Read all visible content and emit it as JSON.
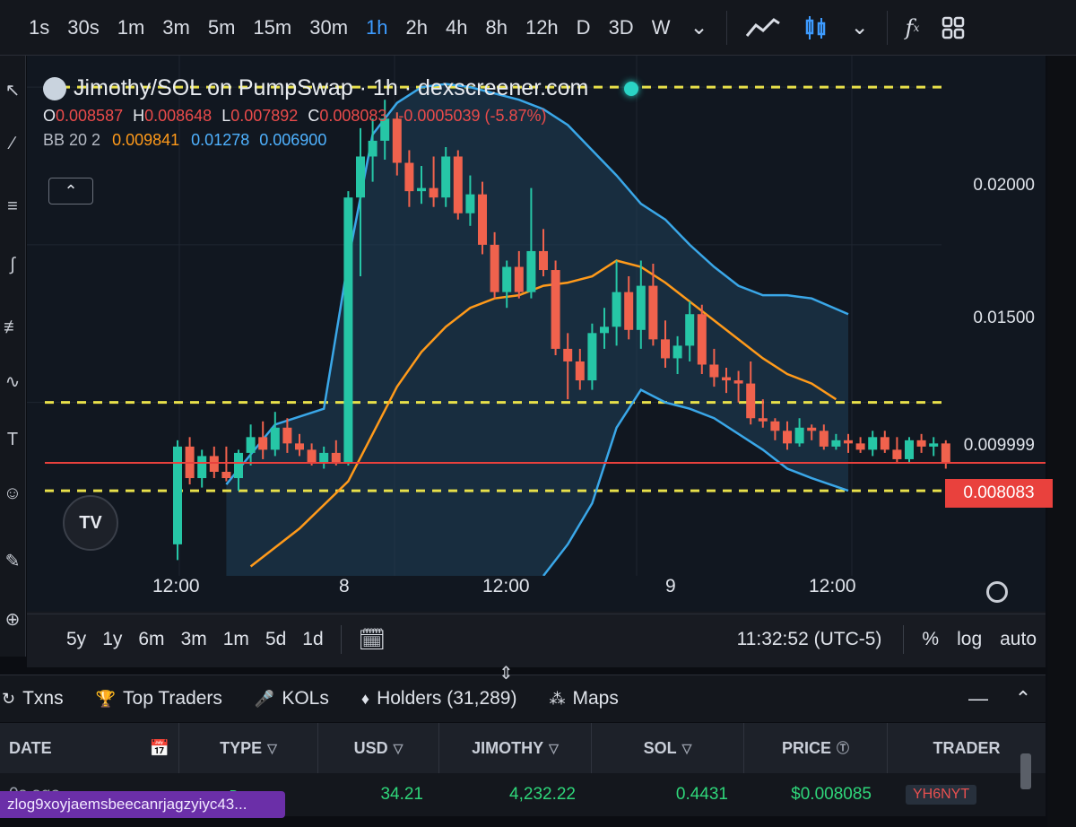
{
  "topbar": {
    "timeframes": [
      "1s",
      "30s",
      "1m",
      "3m",
      "5m",
      "15m",
      "30m",
      "1h",
      "2h",
      "4h",
      "8h",
      "12h",
      "D",
      "3D",
      "W"
    ],
    "active": "1h",
    "icons": [
      "chevron-down-icon",
      "line-chart-icon",
      "candles-icon",
      "chevron-down-icon",
      "indicators-fx-icon",
      "layout-grid-icon"
    ]
  },
  "legend": {
    "title": "Jimothy/SOL on PumpSwap · 1h · dexscreener.com",
    "o_label": "O",
    "o": "0.008587",
    "h_label": "H",
    "h": "0.008648",
    "l_label": "L",
    "l": "0.007892",
    "c_label": "C",
    "c": "0.008083",
    "change": "-0.0005039 (-5.87%)",
    "bb_label": "BB 20 2",
    "bb_mid": "0.009841",
    "bb_upper": "0.01278",
    "bb_lower": "0.006900"
  },
  "axis": {
    "price_labels": [
      "0.02000",
      "0.01500",
      "0.009999"
    ],
    "current_price": "0.008083",
    "time_labels": [
      "12:00",
      "8",
      "12:00",
      "9",
      "12:00"
    ]
  },
  "chart_data": {
    "type": "candlestick",
    "ylim": [
      0.0045,
      0.021
    ],
    "colors": {
      "up": "#26c6a6",
      "down": "#f0624d",
      "bb_mid": "#ff9a1a",
      "bb_band": "#3aa7e8",
      "hline": "#e8e04a",
      "price_line": "#e9413d"
    },
    "horizontal_lines": [
      0.02,
      0.01,
      0.0072
    ],
    "candles": [
      [
        0.0055,
        0.0088,
        0.005,
        0.0086
      ],
      [
        0.0086,
        0.0089,
        0.0074,
        0.0076
      ],
      [
        0.0076,
        0.0085,
        0.0073,
        0.0083
      ],
      [
        0.0083,
        0.0086,
        0.0076,
        0.0078
      ],
      [
        0.0078,
        0.0086,
        0.0075,
        0.0076
      ],
      [
        0.0076,
        0.0085,
        0.0072,
        0.0084
      ],
      [
        0.0084,
        0.0093,
        0.008,
        0.0089
      ],
      [
        0.0089,
        0.0094,
        0.0082,
        0.0085
      ],
      [
        0.0085,
        0.0097,
        0.0083,
        0.0092
      ],
      [
        0.0092,
        0.0095,
        0.0084,
        0.0087
      ],
      [
        0.0087,
        0.009,
        0.0083,
        0.0085
      ],
      [
        0.0085,
        0.0087,
        0.008,
        0.0081
      ],
      [
        0.0081,
        0.0086,
        0.0079,
        0.0084
      ],
      [
        0.0084,
        0.0088,
        0.008,
        0.0081
      ],
      [
        0.0081,
        0.0167,
        0.008,
        0.0165
      ],
      [
        0.0165,
        0.0187,
        0.014,
        0.0178
      ],
      [
        0.0178,
        0.019,
        0.017,
        0.0183
      ],
      [
        0.0183,
        0.0196,
        0.0177,
        0.019
      ],
      [
        0.019,
        0.0192,
        0.0172,
        0.0176
      ],
      [
        0.0176,
        0.018,
        0.0162,
        0.0167
      ],
      [
        0.0167,
        0.0175,
        0.0163,
        0.0168
      ],
      [
        0.0168,
        0.0178,
        0.0162,
        0.0165
      ],
      [
        0.0165,
        0.0181,
        0.0162,
        0.0178
      ],
      [
        0.0178,
        0.018,
        0.0158,
        0.016
      ],
      [
        0.016,
        0.0172,
        0.0156,
        0.0166
      ],
      [
        0.0166,
        0.017,
        0.0147,
        0.015
      ],
      [
        0.015,
        0.0154,
        0.0133,
        0.0135
      ],
      [
        0.0135,
        0.0145,
        0.013,
        0.0143
      ],
      [
        0.0143,
        0.0148,
        0.0133,
        0.0135
      ],
      [
        0.0135,
        0.0168,
        0.0133,
        0.0148
      ],
      [
        0.0148,
        0.0155,
        0.014,
        0.0142
      ],
      [
        0.0142,
        0.0145,
        0.0115,
        0.0117
      ],
      [
        0.0117,
        0.0122,
        0.0101,
        0.0113
      ],
      [
        0.0113,
        0.0117,
        0.0104,
        0.0107
      ],
      [
        0.0107,
        0.0125,
        0.0104,
        0.0122
      ],
      [
        0.0122,
        0.013,
        0.0117,
        0.0124
      ],
      [
        0.0124,
        0.0145,
        0.0118,
        0.0135
      ],
      [
        0.0135,
        0.014,
        0.012,
        0.0123
      ],
      [
        0.0123,
        0.0145,
        0.0117,
        0.0137
      ],
      [
        0.0137,
        0.0144,
        0.0118,
        0.012
      ],
      [
        0.012,
        0.0126,
        0.0111,
        0.0114
      ],
      [
        0.0114,
        0.0121,
        0.0109,
        0.0118
      ],
      [
        0.0118,
        0.0132,
        0.0113,
        0.0128
      ],
      [
        0.0128,
        0.0131,
        0.0109,
        0.0112
      ],
      [
        0.0112,
        0.0117,
        0.0105,
        0.0108
      ],
      [
        0.0108,
        0.0111,
        0.0103,
        0.0107
      ],
      [
        0.0107,
        0.011,
        0.01,
        0.0106
      ],
      [
        0.0106,
        0.0113,
        0.0093,
        0.0095
      ],
      [
        0.0095,
        0.0101,
        0.0092,
        0.0094
      ],
      [
        0.0094,
        0.0095,
        0.0088,
        0.0091
      ],
      [
        0.0091,
        0.0094,
        0.0085,
        0.0087
      ],
      [
        0.0087,
        0.0095,
        0.0086,
        0.0092
      ],
      [
        0.0092,
        0.0093,
        0.0088,
        0.0091
      ],
      [
        0.0091,
        0.0093,
        0.0085,
        0.0086
      ],
      [
        0.0086,
        0.009,
        0.0085,
        0.0088
      ],
      [
        0.0088,
        0.009,
        0.0084,
        0.0087
      ],
      [
        0.0087,
        0.0089,
        0.0084,
        0.0085
      ],
      [
        0.0085,
        0.0091,
        0.0083,
        0.0089
      ],
      [
        0.0089,
        0.0091,
        0.0084,
        0.0085
      ],
      [
        0.0085,
        0.0089,
        0.0081,
        0.0082
      ],
      [
        0.0082,
        0.0089,
        0.0081,
        0.0088
      ],
      [
        0.0088,
        0.009,
        0.0084,
        0.0086
      ],
      [
        0.0086,
        0.0089,
        0.0083,
        0.0087
      ],
      [
        0.0087,
        0.0088,
        0.0079,
        0.0081
      ]
    ],
    "bb_upper": [
      [
        4,
        0.0074
      ],
      [
        8,
        0.0093
      ],
      [
        12,
        0.0098
      ],
      [
        14,
        0.0145
      ],
      [
        16,
        0.0185
      ],
      [
        18,
        0.0195
      ],
      [
        20,
        0.02
      ],
      [
        22,
        0.0201
      ],
      [
        24,
        0.02
      ],
      [
        26,
        0.0198
      ],
      [
        28,
        0.0196
      ],
      [
        30,
        0.0193
      ],
      [
        32,
        0.0188
      ],
      [
        34,
        0.018
      ],
      [
        36,
        0.0172
      ],
      [
        38,
        0.0163
      ],
      [
        40,
        0.0158
      ],
      [
        42,
        0.015
      ],
      [
        44,
        0.0143
      ],
      [
        46,
        0.0137
      ],
      [
        48,
        0.0134
      ],
      [
        50,
        0.0134
      ],
      [
        52,
        0.0133
      ],
      [
        55,
        0.0128
      ]
    ],
    "bb_mid": [
      [
        6,
        0.0048
      ],
      [
        10,
        0.006
      ],
      [
        14,
        0.0075
      ],
      [
        16,
        0.009
      ],
      [
        18,
        0.0105
      ],
      [
        20,
        0.0116
      ],
      [
        22,
        0.0124
      ],
      [
        24,
        0.013
      ],
      [
        26,
        0.0133
      ],
      [
        28,
        0.0134
      ],
      [
        30,
        0.0137
      ],
      [
        32,
        0.0138
      ],
      [
        34,
        0.014
      ],
      [
        36,
        0.0145
      ],
      [
        38,
        0.0143
      ],
      [
        40,
        0.0138
      ],
      [
        42,
        0.0132
      ],
      [
        44,
        0.0126
      ],
      [
        46,
        0.012
      ],
      [
        48,
        0.0114
      ],
      [
        50,
        0.0109
      ],
      [
        52,
        0.0106
      ],
      [
        54,
        0.0101
      ]
    ],
    "bb_lower": [
      [
        30,
        0.0045
      ],
      [
        32,
        0.0055
      ],
      [
        34,
        0.0068
      ],
      [
        36,
        0.0092
      ],
      [
        38,
        0.0104
      ],
      [
        40,
        0.01
      ],
      [
        42,
        0.0098
      ],
      [
        44,
        0.0095
      ],
      [
        46,
        0.009
      ],
      [
        48,
        0.0085
      ],
      [
        50,
        0.0079
      ],
      [
        52,
        0.0076
      ],
      [
        55,
        0.0072
      ]
    ]
  },
  "rangebar": {
    "ranges": [
      "5y",
      "1y",
      "6m",
      "3m",
      "1m",
      "5d",
      "1d"
    ],
    "clock": "11:32:52 (UTC-5)",
    "opts": [
      "%",
      "log",
      "auto"
    ]
  },
  "tabs": {
    "items": [
      {
        "label": "Txns",
        "icon": "refresh-icon"
      },
      {
        "label": "Top Traders",
        "icon": "trophy-icon"
      },
      {
        "label": "KOLs",
        "icon": "microphone-icon"
      },
      {
        "label": "Holders (31,289)",
        "icon": "diamond-icon"
      },
      {
        "label": "Maps",
        "icon": "bubble-map-icon"
      }
    ]
  },
  "table": {
    "headers": [
      "DATE",
      "TYPE",
      "USD",
      "JIMOTHY",
      "SOL",
      "PRICE",
      "TRADER"
    ],
    "row": {
      "date": "0s ago",
      "type": "Buy",
      "usd": "34.21",
      "jimothy": "4,232.22",
      "sol": "0.4431",
      "price": "$0.008085",
      "trader": "YH6NYT"
    }
  },
  "address": "zlog9xoyjaemsbeecanrjagzyiyc43..."
}
